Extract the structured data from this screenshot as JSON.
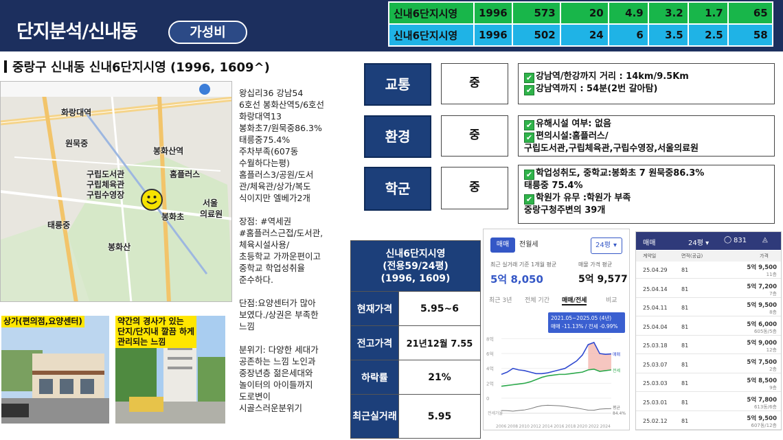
{
  "header": {
    "title": "단지분석/신내동",
    "badge": "가성비"
  },
  "top_table": {
    "rows": [
      {
        "name": "신내6단지시영",
        "year": "1996",
        "c1": "573",
        "c2": "20",
        "c3": "4.9",
        "c4": "3.2",
        "c5": "1.7",
        "c6": "65"
      },
      {
        "name": "신내6단지시영",
        "year": "1996",
        "c1": "502",
        "c2": "24",
        "c3": "6",
        "c4": "3.5",
        "c5": "2.5",
        "c6": "58"
      }
    ],
    "colors": {
      "row0": "#18b64a",
      "row1": "#1fb3e6"
    }
  },
  "subtitle": "중랑구 신내동 신내6단지시영  (1996, 1609^)",
  "map": {
    "labels": {
      "hwarang": "화랑대역",
      "wonmuk": "원묵중",
      "library": "구립도서관",
      "gym": "구립체육관",
      "pool": "구립수영장",
      "bonghwa_station": "봉화산역",
      "homeplus": "홈플러스",
      "seoul": "서울",
      "medical": "의료원",
      "taereung": "태릉중",
      "bonghwacho": "봉화초",
      "bonghwasan": "봉화산"
    }
  },
  "photos": {
    "left_caption": "상가(편의점,요양센터)",
    "right_caption_1": "약간의 경사가 있는",
    "right_caption_2": "단지/단지내 깔끔 하게",
    "right_caption_3": "관리되는 느낌"
  },
  "desc": {
    "b1": [
      "왕십리36 강남54",
      "6호선 봉화산역5/6호선",
      "화랑대역13",
      "봉화초7/원묵중86.3%",
      "태릉중75.4%",
      "주차부족(607동",
      "수월하다는평)",
      "홈플러스3/공원/도서",
      "관/체육관/상가/복도",
      "식이지만 엘베가2개"
    ],
    "b2": [
      "장점: #역세권",
      "#홈플러스근접/도서관,",
      "체육시설사용/",
      "초등학교 가까운편이고",
      "중학교 학업성취율",
      "준수하다."
    ],
    "b3": [
      "단점:요양센터가 많아",
      "보였다./상권은 부족한",
      "느낌"
    ],
    "b4": [
      "분위기: 다양한 세대가",
      "공존하는 느낌 노인과",
      "중장년층 젊은세대와",
      "놀이터의 아이들까지",
      "도로변이",
      "시골스러운분위기"
    ]
  },
  "eval": {
    "traffic": {
      "label": "교통",
      "grade": "중",
      "lines": [
        "강남역/한강까지 거리 : 14km/9.5Km",
        "강남역까지 : 54분(2번 갈아탐)"
      ]
    },
    "env": {
      "label": "환경",
      "grade": "중",
      "lines": [
        "유해시설 여부: 없음",
        "편의시설:홈플러스/",
        "구립도서관,구립체육관,구립수영장,서울의료원"
      ]
    },
    "school": {
      "label": "학군",
      "grade": "중",
      "lines": [
        "학업성취도, 중학교:봉화초 7 원묵중86.3%",
        "태릉중 75.4%",
        "학원가 유무 :학원가 부족",
        "중랑구청주변의 39개"
      ]
    }
  },
  "price": {
    "header": [
      "신내6단지시영",
      "(전용59/24평)",
      "(1996, 1609)"
    ],
    "rows": [
      {
        "label": "현재가격",
        "value": "5.95~6"
      },
      {
        "label": "전고가격",
        "value": "21년12월  7.55"
      },
      {
        "label": "하락률",
        "value": "21%"
      },
      {
        "label": "최근실거래",
        "value": "5.95"
      }
    ]
  },
  "chart_app": {
    "tabs": [
      "매매",
      "전월세"
    ],
    "select": "24평",
    "recent_label": "최근 실거래 기준 1개월 평균",
    "avg_label": "매물 가격 평균",
    "recent_value": "5억 8,050",
    "avg_value": "5억 9,577",
    "periods": [
      "최근 3년",
      "전체 기간",
      "매매/전세",
      "비교"
    ],
    "tooltip_1": "2021.05~2025.05 (4년)",
    "tooltip_2": "매매 -11.13%  /  전세 -0.99%",
    "y_ticks": [
      "8억",
      "6억",
      "4억",
      "2억",
      "0"
    ],
    "x_ticks": [
      "2006",
      "2008",
      "2010",
      "2012",
      "2014",
      "2016",
      "2018",
      "2020",
      "2022",
      "2024"
    ],
    "legend_sale": "매매",
    "legend_rent": "전세",
    "legend_ratio": "평균",
    "ratio_value": "84.4%",
    "ratio_label": "전세가율"
  },
  "chart_data": {
    "type": "line",
    "x": [
      2006,
      2007,
      2008,
      2009,
      2010,
      2011,
      2012,
      2013,
      2014,
      2015,
      2016,
      2017,
      2018,
      2019,
      2020,
      2021,
      2022,
      2023,
      2024,
      2025
    ],
    "series": [
      {
        "name": "매매",
        "values": [
          3.2,
          3.5,
          4.0,
          3.8,
          3.7,
          3.5,
          3.3,
          3.3,
          3.4,
          3.6,
          3.8,
          4.0,
          4.5,
          5.0,
          5.8,
          7.2,
          7.5,
          6.0,
          5.9,
          5.95
        ]
      },
      {
        "name": "전세",
        "values": [
          1.6,
          1.7,
          1.8,
          1.9,
          2.0,
          2.2,
          2.5,
          2.8,
          3.0,
          3.1,
          3.2,
          3.2,
          3.3,
          3.4,
          3.5,
          3.8,
          3.9,
          3.6,
          3.7,
          3.8
        ]
      }
    ],
    "ylim": [
      0,
      8.5
    ]
  },
  "list_app": {
    "tab": "매매",
    "select": "24평",
    "count": "831",
    "col_date": "계약일",
    "col_area": "면적(공급)",
    "col_price": "가격",
    "rows": [
      {
        "date": "25.04.29",
        "area": "81",
        "price": "5억 9,500",
        "floor": "11층"
      },
      {
        "date": "25.04.14",
        "area": "81",
        "price": "5억 7,200",
        "floor": "7층"
      },
      {
        "date": "25.04.11",
        "area": "81",
        "price": "5억 9,500",
        "floor": "8층"
      },
      {
        "date": "25.04.04",
        "area": "81",
        "price": "5억 6,000",
        "floor": "605동/5층"
      },
      {
        "date": "25.03.18",
        "area": "81",
        "price": "5억 9,000",
        "floor": "12층"
      },
      {
        "date": "25.03.07",
        "area": "81",
        "price": "5억 7,500",
        "floor": "2층"
      },
      {
        "date": "25.03.03",
        "area": "81",
        "price": "5억 8,500",
        "floor": "9층"
      },
      {
        "date": "25.03.01",
        "area": "81",
        "price": "5억 7,800",
        "floor": "613동/6층"
      },
      {
        "date": "25.02.12",
        "area": "81",
        "price": "5억 9,500",
        "floor": "607동/12층"
      }
    ]
  }
}
